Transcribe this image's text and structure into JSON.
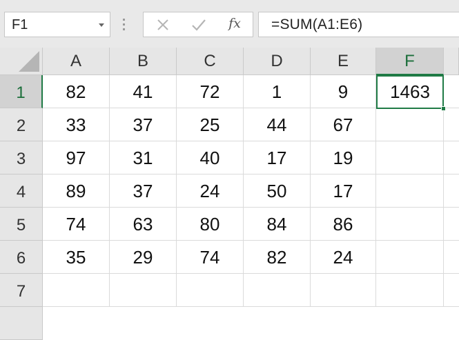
{
  "name_box": {
    "value": "F1"
  },
  "formula_bar": {
    "cancel_icon": "x-icon",
    "enter_icon": "check-icon",
    "function_label": "fx",
    "formula": "=SUM(A1:E6)"
  },
  "columns": [
    "A",
    "B",
    "C",
    "D",
    "E",
    "F"
  ],
  "rows": [
    "1",
    "2",
    "3",
    "4",
    "5",
    "6",
    "7"
  ],
  "cells": [
    [
      "82",
      "41",
      "72",
      "1",
      "9",
      "1463"
    ],
    [
      "33",
      "37",
      "25",
      "44",
      "67",
      ""
    ],
    [
      "97",
      "31",
      "40",
      "17",
      "19",
      ""
    ],
    [
      "89",
      "37",
      "24",
      "50",
      "17",
      ""
    ],
    [
      "74",
      "63",
      "80",
      "84",
      "86",
      ""
    ],
    [
      "35",
      "29",
      "74",
      "82",
      "24",
      ""
    ],
    [
      "",
      "",
      "",
      "",
      "",
      ""
    ]
  ],
  "selection": {
    "column": "F",
    "row": "1"
  },
  "colors": {
    "selection": "#1f7a45",
    "header_bg": "#e6e6e6",
    "gridline": "#dadada"
  }
}
